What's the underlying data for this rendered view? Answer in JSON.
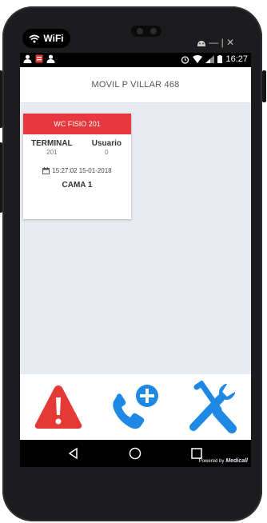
{
  "device": {
    "wifi_label": "WiFi",
    "top_right_glyphs": "— | ✕"
  },
  "status_bar": {
    "time": "16:27"
  },
  "app": {
    "title": "MOVIL P VILLAR 468"
  },
  "card": {
    "header": "WC FISIO 201",
    "terminal_label": "TERMINAL",
    "terminal_value": "201",
    "usuario_label": "Usuario",
    "usuario_value": "0",
    "timestamp": "15:27:02 15-01-2018",
    "bed": "CAMA 1"
  },
  "actions": {
    "alert_icon": "warning-icon",
    "call_icon": "add-call-icon",
    "tools_icon": "tools-icon",
    "colors": {
      "alert": "#e53935",
      "call": "#1e88e5",
      "tools": "#1e88e5"
    }
  },
  "nav": {
    "powered_prefix": "Powered by",
    "powered_brand": "Medicall"
  },
  "colors": {
    "card_header": "#e8383d",
    "screen_bg": "#e8ebf0"
  }
}
